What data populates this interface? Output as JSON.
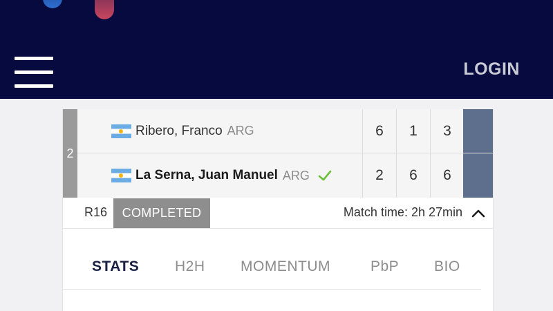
{
  "header": {
    "login_label": "LOGIN",
    "bg_color": "#060a3e"
  },
  "match": {
    "seed": "2",
    "players": [
      {
        "name": "Ribero, Franco",
        "country": "ARG",
        "winner": false,
        "scores": [
          "6",
          "1",
          "3"
        ]
      },
      {
        "name": "La Serna, Juan Manuel",
        "country": "ARG",
        "winner": true,
        "scores": [
          "2",
          "6",
          "6"
        ]
      }
    ],
    "round": "R16",
    "status": "COMPLETED",
    "match_time": "Match time: 2h 27min"
  },
  "tabs": [
    {
      "label": "STATS",
      "active": true
    },
    {
      "label": "H2H",
      "active": false
    },
    {
      "label": "MOMENTUM",
      "active": false
    },
    {
      "label": "PbP",
      "active": false
    },
    {
      "label": "BIO",
      "active": false
    }
  ],
  "colors": {
    "accent": "#1a2145",
    "status_bar": "#5e6f8e",
    "winner_check": "#6bbf3a"
  }
}
